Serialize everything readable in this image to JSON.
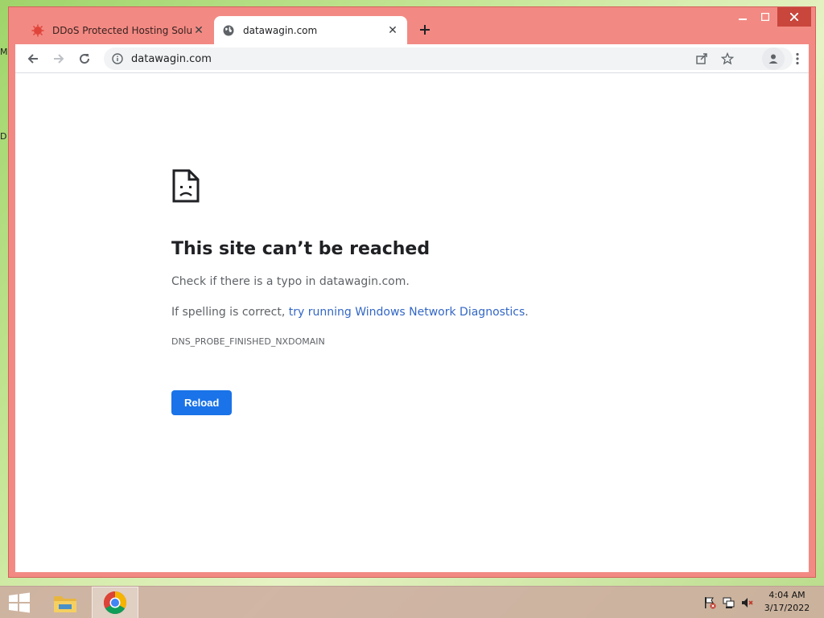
{
  "desktop": {
    "left_labels": [
      "M",
      "D"
    ]
  },
  "browser": {
    "tabs": [
      {
        "title": "DDoS Protected Hosting Solution",
        "active": false,
        "favicon": "red-virus-icon"
      },
      {
        "title": "datawagin.com",
        "active": true,
        "favicon": "globe-icon"
      }
    ],
    "window_controls": [
      "minimize-icon",
      "maximize-icon",
      "close-icon"
    ],
    "toolbar": {
      "back": "back-arrow-icon",
      "forward": "forward-arrow-icon",
      "reload": "reload-icon",
      "url": "datawagin.com",
      "right_icons": [
        "share-icon",
        "star-icon",
        "profile-icon",
        "menu-icon"
      ]
    }
  },
  "error_page": {
    "title": "This site can’t be reached",
    "line1": "Check if there is a typo in datawagin.com.",
    "line2_prefix": "If spelling is correct, ",
    "line2_link": "try running Windows Network Diagnostics",
    "line2_suffix": ".",
    "code": "DNS_PROBE_FINISHED_NXDOMAIN",
    "button": "Reload"
  },
  "taskbar": {
    "apps": [
      "windows-start-icon",
      "file-explorer-icon",
      "chrome-icon"
    ],
    "tray": [
      "action-center-flag-icon",
      "network-icon",
      "volume-muted-icon"
    ],
    "time": "4:04 AM",
    "date": "3/17/2022"
  },
  "colors": {
    "window_frame": "#f28a83",
    "accent": "#1a73e8",
    "link": "#3367c5"
  }
}
